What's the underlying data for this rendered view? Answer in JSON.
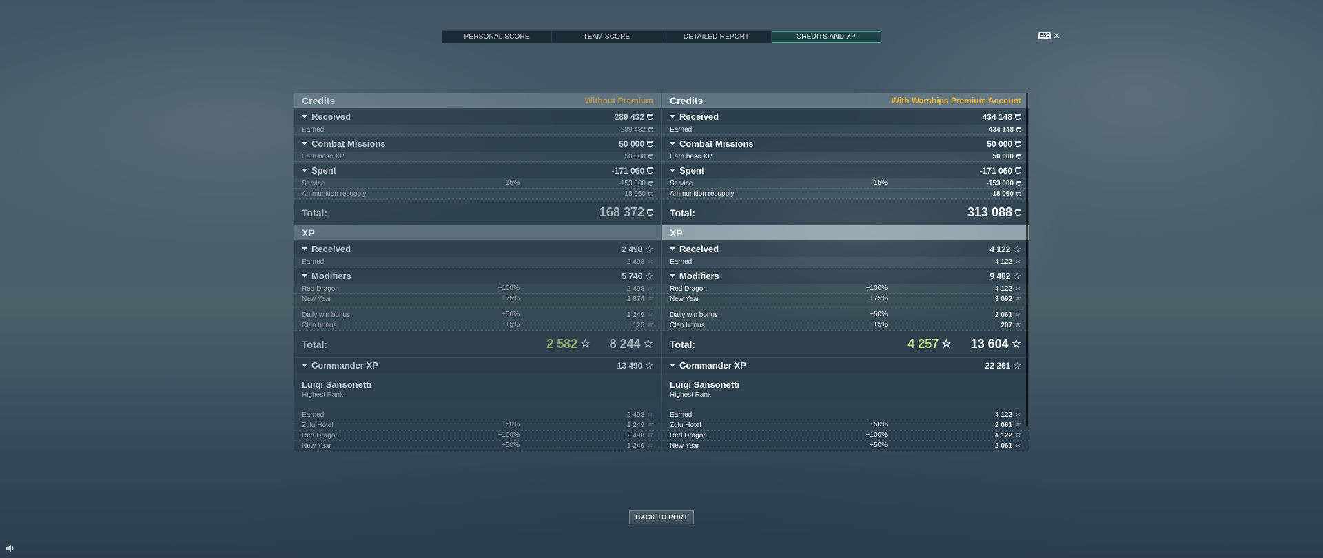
{
  "tabs": [
    {
      "label": "PERSONAL SCORE"
    },
    {
      "label": "TEAM SCORE"
    },
    {
      "label": "DETAILED REPORT"
    },
    {
      "label": "CREDITS AND XP"
    }
  ],
  "esc_label": "ESC",
  "back_button": "BACK TO PORT",
  "left": {
    "credits_title": "Credits",
    "credits_sub": "Without Premium",
    "received": {
      "label": "Received",
      "value": "289 432"
    },
    "earned": {
      "label": "Earned",
      "value": "289 432"
    },
    "combat": {
      "label": "Combat Missions",
      "value": "50 000"
    },
    "earn_base": {
      "label": "Earn base XP",
      "value": "50 000"
    },
    "spent": {
      "label": "Spent",
      "value": "-171 060"
    },
    "service": {
      "label": "Service",
      "pct": "-15%",
      "value": "-153 000"
    },
    "ammo": {
      "label": "Ammunition resupply",
      "value": "-18 060"
    },
    "credits_total": {
      "label": "Total:",
      "value": "168 372"
    },
    "xp_title": "XP",
    "xp_received": {
      "label": "Received",
      "value": "2 498"
    },
    "xp_earned": {
      "label": "Earned",
      "value": "2 498"
    },
    "modifiers": {
      "label": "Modifiers",
      "value": "5 746"
    },
    "red_dragon": {
      "label": "Red Dragon",
      "pct": "+100%",
      "value": "2 498"
    },
    "new_year": {
      "label": "New Year",
      "pct": "+75%",
      "value": "1 874"
    },
    "daily_win": {
      "label": "Daily win bonus",
      "pct": "+50%",
      "value": "1 249"
    },
    "clan": {
      "label": "Clan bonus",
      "pct": "+5%",
      "value": "125"
    },
    "xp_total": {
      "label": "Total:",
      "free": "2 582",
      "value": "8 244"
    },
    "commander_xp": {
      "label": "Commander XP",
      "value": "13 490"
    },
    "commander": {
      "name": "Luigi Sansonetti",
      "rank": "Highest Rank"
    },
    "c_earned": {
      "label": "Earned",
      "value": "2 498"
    },
    "c_zulu": {
      "label": "Zulu Hotel",
      "pct": "+50%",
      "value": "1 249"
    },
    "c_red_dragon": {
      "label": "Red Dragon",
      "pct": "+100%",
      "value": "2 498"
    },
    "c_new_year": {
      "label": "New Year",
      "pct": "+50%",
      "value": "1 249"
    }
  },
  "right": {
    "credits_title": "Credits",
    "credits_sub": "With Warships Premium Account",
    "received": {
      "label": "Received",
      "value": "434 148"
    },
    "earned": {
      "label": "Earned",
      "value": "434 148"
    },
    "combat": {
      "label": "Combat Missions",
      "value": "50 000"
    },
    "earn_base": {
      "label": "Earn base XP",
      "value": "50 000"
    },
    "spent": {
      "label": "Spent",
      "value": "-171 060"
    },
    "service": {
      "label": "Service",
      "pct": "-15%",
      "value": "-153 000"
    },
    "ammo": {
      "label": "Ammunition resupply",
      "value": "-18 060"
    },
    "credits_total": {
      "label": "Total:",
      "value": "313 088"
    },
    "xp_title": "XP",
    "xp_received": {
      "label": "Received",
      "value": "4 122"
    },
    "xp_earned": {
      "label": "Earned",
      "value": "4 122"
    },
    "modifiers": {
      "label": "Modifiers",
      "value": "9 482"
    },
    "red_dragon": {
      "label": "Red Dragon",
      "pct": "+100%",
      "value": "4 122"
    },
    "new_year": {
      "label": "New Year",
      "pct": "+75%",
      "value": "3 092"
    },
    "daily_win": {
      "label": "Daily win bonus",
      "pct": "+50%",
      "value": "2 061"
    },
    "clan": {
      "label": "Clan bonus",
      "pct": "+5%",
      "value": "207"
    },
    "xp_total": {
      "label": "Total:",
      "free": "4 257",
      "value": "13 604"
    },
    "commander_xp": {
      "label": "Commander XP",
      "value": "22 261"
    },
    "commander": {
      "name": "Luigi Sansonetti",
      "rank": "Highest Rank"
    },
    "c_earned": {
      "label": "Earned",
      "value": "4 122"
    },
    "c_zulu": {
      "label": "Zulu Hotel",
      "pct": "+50%",
      "value": "2 061"
    },
    "c_red_dragon": {
      "label": "Red Dragon",
      "pct": "+100%",
      "value": "4 122"
    },
    "c_new_year": {
      "label": "New Year",
      "pct": "+50%",
      "value": "2 061"
    }
  }
}
